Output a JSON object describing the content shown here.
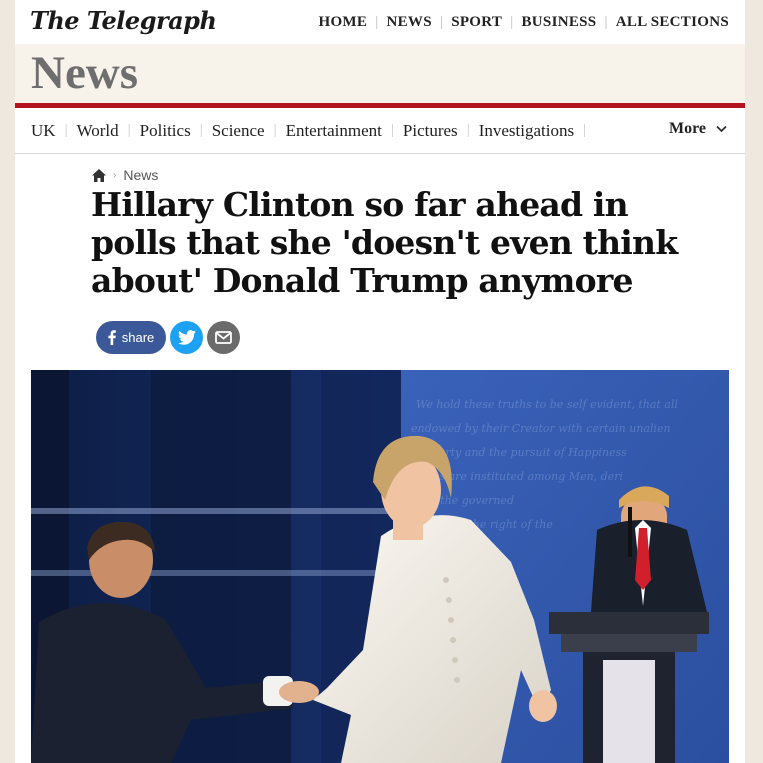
{
  "masthead": {
    "logo": "The Telegraph",
    "nav": [
      "HOME",
      "NEWS",
      "SPORT",
      "BUSINESS",
      "ALL SECTIONS"
    ]
  },
  "section": {
    "title": "News"
  },
  "subnav": {
    "items": [
      "UK",
      "World",
      "Politics",
      "Science",
      "Entertainment",
      "Pictures",
      "Investigations"
    ],
    "more": "More"
  },
  "breadcrumb": {
    "section": "News"
  },
  "article": {
    "headline": "Hillary Clinton so far ahead in polls that she 'doesn't even think about' Donald Trump anymore"
  },
  "share": {
    "facebook_label": "share"
  },
  "colors": {
    "accent_red": "#b3141e",
    "facebook": "#3b5998",
    "twitter": "#1da1f2"
  }
}
